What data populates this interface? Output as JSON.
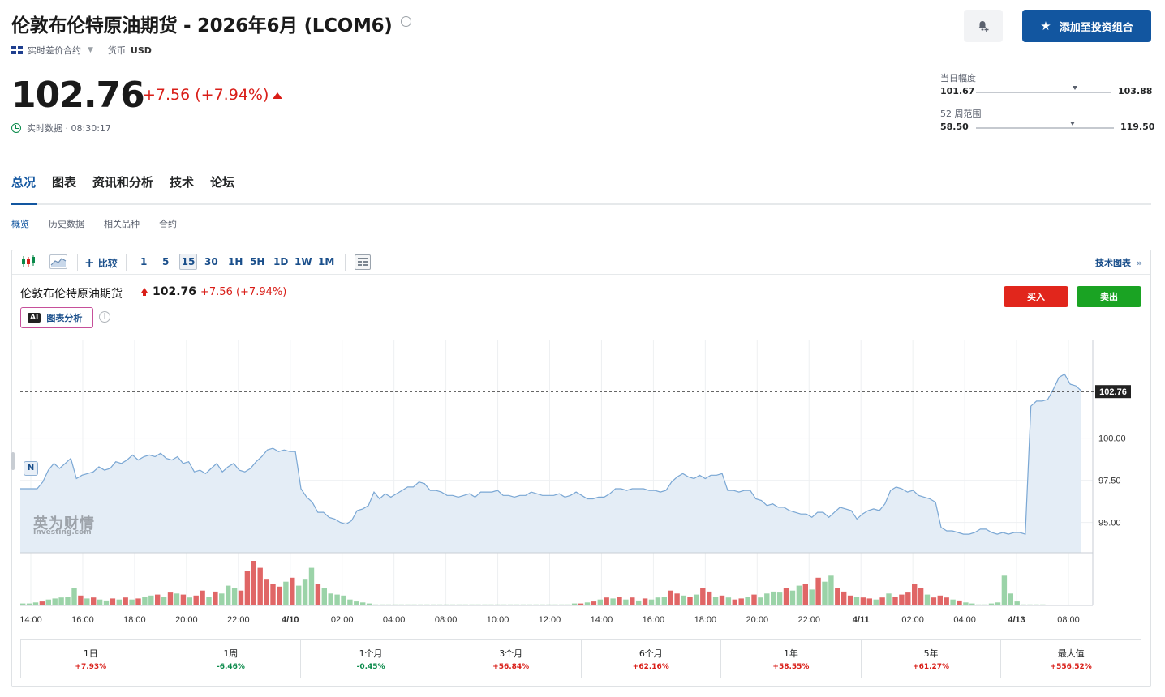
{
  "header": {
    "title": "伦敦布伦特原油期货 - 2026年6月 (LCOM6)",
    "info_glyph": "i",
    "contract_type": "实时差价合约",
    "currency_label": "货币",
    "currency": "USD",
    "portfolio_button": "添加至投资组合"
  },
  "quote": {
    "price": "102.76",
    "change": "+7.56 (+7.94%)",
    "live_status": "实时数据 · 08:30:17",
    "day_range": {
      "label": "当日幅度",
      "low": "101.67",
      "high": "103.88",
      "position": 0.73
    },
    "week52_range": {
      "label": "52 周范围",
      "low": "58.50",
      "high": "119.50",
      "position": 0.7
    }
  },
  "tabs": [
    "总况",
    "图表",
    "资讯和分析",
    "技术",
    "论坛"
  ],
  "subtabs": [
    "概览",
    "历史数据",
    "相关品种",
    "合约"
  ],
  "toolbar": {
    "compare": "比较",
    "intervals": [
      "1",
      "5",
      "15",
      "30",
      "1H",
      "5H",
      "1D",
      "1W",
      "1M"
    ],
    "active_interval": "15",
    "tech_chart_link": "技术图表"
  },
  "chart_header": {
    "name": "伦敦布伦特原油期货",
    "price": "102.76",
    "change": "+7.56 (+7.94%)",
    "ai_badge": "AI",
    "ai_label": "图表分析",
    "info_glyph": "i",
    "buy": "买入",
    "sell": "卖出",
    "news_marker": "N",
    "watermark_cn": "英为财情",
    "watermark_en": "Investing.com"
  },
  "chart_data": {
    "type": "area",
    "price_label": "102.76",
    "yticks": [
      "100.00",
      "97.50",
      "95.00"
    ],
    "ylim": [
      93.2,
      105.8
    ],
    "xticks": [
      "14:00",
      "16:00",
      "18:00",
      "20:00",
      "22:00",
      "4/10",
      "02:00",
      "04:00",
      "08:00",
      "10:00",
      "12:00",
      "14:00",
      "16:00",
      "18:00",
      "20:00",
      "22:00",
      "4/11",
      "02:00",
      "04:00",
      "4/13",
      "08:00"
    ],
    "price_series": [
      97.0,
      97.0,
      97.0,
      97.0,
      97.4,
      98.1,
      98.5,
      98.2,
      98.5,
      98.8,
      97.6,
      97.8,
      97.9,
      98.0,
      98.3,
      98.1,
      98.2,
      98.6,
      98.5,
      98.7,
      99.0,
      98.7,
      98.9,
      99.0,
      98.9,
      99.1,
      98.8,
      98.7,
      98.9,
      98.5,
      98.6,
      98.0,
      98.1,
      97.9,
      98.2,
      98.5,
      98.0,
      98.3,
      98.5,
      98.1,
      98.0,
      98.2,
      98.6,
      98.9,
      99.3,
      99.4,
      99.2,
      99.3,
      99.2,
      99.2,
      97.0,
      96.5,
      96.2,
      95.6,
      95.6,
      95.3,
      95.2,
      95.0,
      94.9,
      95.1,
      95.7,
      95.8,
      96.0,
      96.8,
      96.4,
      96.7,
      96.5,
      96.7,
      96.9,
      97.1,
      97.1,
      97.4,
      97.3,
      96.9,
      96.9,
      96.8,
      96.6,
      96.6,
      96.5,
      96.6,
      96.7,
      96.5,
      96.8,
      96.8,
      96.8,
      96.9,
      96.6,
      96.6,
      96.5,
      96.6,
      96.6,
      96.8,
      96.7,
      96.6,
      96.6,
      96.6,
      96.7,
      96.5,
      96.6,
      96.8,
      96.6,
      96.4,
      96.4,
      96.5,
      96.5,
      96.7,
      97.0,
      97.0,
      96.9,
      97.0,
      97.0,
      97.0,
      96.9,
      96.9,
      96.8,
      96.9,
      97.4,
      97.7,
      97.9,
      97.7,
      97.6,
      97.8,
      97.6,
      97.8,
      97.8,
      97.9,
      96.9,
      96.9,
      96.8,
      96.9,
      96.9,
      96.4,
      96.3,
      96.0,
      96.1,
      95.9,
      95.9,
      95.7,
      95.6,
      95.5,
      95.5,
      95.3,
      95.6,
      95.6,
      95.3,
      95.6,
      95.9,
      95.8,
      95.7,
      95.2,
      95.5,
      95.7,
      95.8,
      95.7,
      96.1,
      96.9,
      97.1,
      97.0,
      96.8,
      96.9,
      96.6,
      96.5,
      96.4,
      96.2,
      94.7,
      94.5,
      94.5,
      94.4,
      94.3,
      94.3,
      94.4,
      94.6,
      94.6,
      94.4,
      94.3,
      94.4,
      94.3,
      94.4,
      94.4,
      94.3,
      101.9,
      102.2,
      102.2,
      102.3,
      102.9,
      103.6,
      103.8,
      103.2,
      103.1,
      102.8
    ],
    "volume_series": [
      2,
      2,
      3,
      4,
      6,
      7,
      8,
      9,
      18,
      10,
      7,
      8,
      6,
      5,
      7,
      6,
      8,
      6,
      7,
      9,
      10,
      11,
      9,
      13,
      12,
      11,
      8,
      10,
      15,
      9,
      14,
      12,
      20,
      18,
      15,
      35,
      45,
      38,
      26,
      22,
      19,
      24,
      28,
      20,
      26,
      38,
      22,
      18,
      12,
      11,
      10,
      6,
      4,
      3,
      2,
      1,
      1,
      1,
      1,
      1,
      1,
      1,
      1,
      1,
      1,
      1,
      1,
      1,
      1,
      1,
      1,
      1,
      1,
      1,
      1,
      1,
      1,
      1,
      1,
      1,
      1,
      1,
      1,
      1,
      1,
      1,
      2,
      2,
      3,
      4,
      6,
      8,
      7,
      9,
      6,
      8,
      5,
      7,
      6,
      8,
      9,
      15,
      12,
      10,
      9,
      11,
      18,
      14,
      9,
      10,
      8,
      6,
      7,
      9,
      11,
      8,
      12,
      14,
      13,
      18,
      15,
      20,
      22,
      16,
      28,
      24,
      30,
      18,
      14,
      10,
      9,
      8,
      7,
      6,
      8,
      12,
      9,
      11,
      13,
      22,
      18,
      11,
      8,
      10,
      8,
      6,
      5,
      3,
      2,
      1,
      1,
      2,
      3,
      30,
      12,
      4,
      1,
      1,
      1,
      1
    ],
    "volume_up": [
      true,
      true,
      true,
      false,
      true,
      true,
      true,
      true,
      true,
      false,
      true,
      false,
      true,
      true,
      false,
      true,
      false,
      true,
      false,
      true,
      true,
      false,
      true,
      false,
      true,
      false,
      true,
      false,
      false,
      true,
      false,
      true,
      true,
      true,
      false,
      false,
      false,
      false,
      false,
      false,
      false,
      true,
      false,
      true,
      true,
      true,
      false,
      true,
      true,
      true,
      true,
      true,
      true,
      true,
      true,
      true,
      true,
      true,
      true,
      true,
      true,
      true,
      true,
      true,
      true,
      true,
      true,
      true,
      true,
      true,
      true,
      true,
      true,
      true,
      true,
      true,
      true,
      true,
      true,
      true,
      true,
      true,
      true,
      true,
      true,
      true,
      true,
      false,
      true,
      false,
      true,
      false,
      true,
      false,
      true,
      false,
      true,
      false,
      true,
      true,
      true,
      false,
      false,
      true,
      false,
      true,
      false,
      false,
      true,
      false,
      true,
      false,
      false,
      true,
      false,
      true,
      true,
      true,
      true,
      false,
      true,
      true,
      false,
      true,
      false,
      true,
      true,
      false,
      false,
      false,
      true,
      false,
      false,
      true,
      false,
      true,
      false,
      false,
      false,
      false,
      false,
      true,
      false,
      false,
      false,
      true,
      false,
      true,
      true,
      true,
      true,
      true,
      true,
      true,
      true,
      true,
      true,
      true,
      true,
      true,
      true
    ]
  },
  "performance": [
    {
      "label": "1日",
      "value": "+7.93%",
      "up": true
    },
    {
      "label": "1周",
      "value": "-6.46%",
      "up": false
    },
    {
      "label": "1个月",
      "value": "-0.45%",
      "up": false
    },
    {
      "label": "3个月",
      "value": "+56.84%",
      "up": true
    },
    {
      "label": "6个月",
      "value": "+62.16%",
      "up": true
    },
    {
      "label": "1年",
      "value": "+58.55%",
      "up": true
    },
    {
      "label": "5年",
      "value": "+61.27%",
      "up": true
    },
    {
      "label": "最大值",
      "value": "+556.52%",
      "up": true
    }
  ],
  "colors": {
    "accent": "#1256a0",
    "down_red": "#d91e18",
    "up_green": "#0a8a4a",
    "volume_red": "#e06666",
    "volume_green": "#9bd3a8",
    "area_fill": "#e4edf6",
    "area_line": "#7aa7d4"
  }
}
